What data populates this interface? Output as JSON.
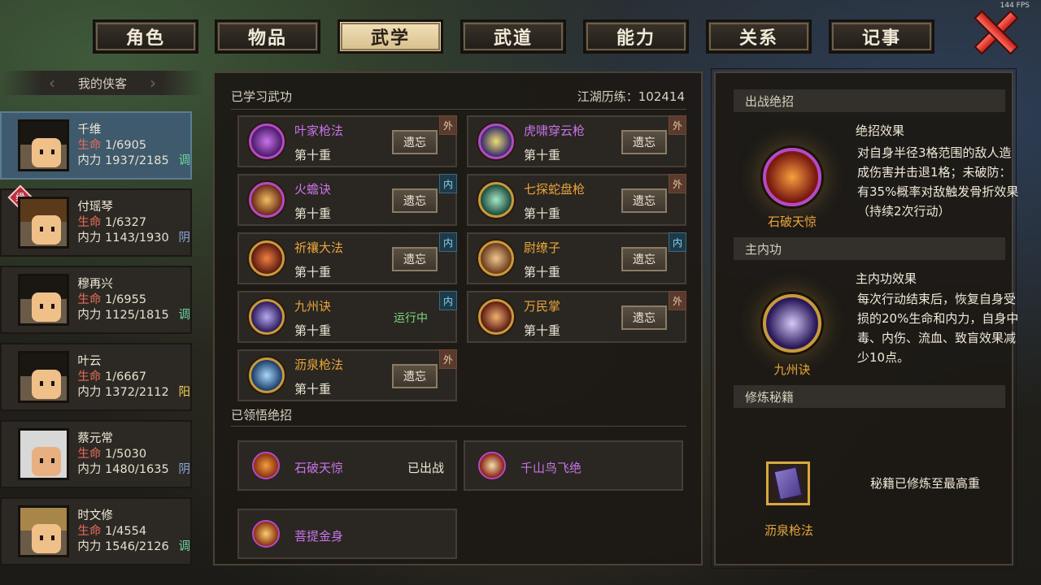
{
  "fps": "144 FPS",
  "tabs": [
    {
      "label": "角色",
      "active": false
    },
    {
      "label": "物品",
      "active": false
    },
    {
      "label": "武学",
      "active": true
    },
    {
      "label": "武道",
      "active": false
    },
    {
      "label": "能力",
      "active": false
    },
    {
      "label": "关系",
      "active": false
    },
    {
      "label": "记事",
      "active": false
    }
  ],
  "roster": {
    "title": "我的侠客",
    "hp_label": "生命",
    "mp_label": "内力",
    "characters": [
      {
        "name": "千维",
        "hp": "1/6905",
        "mp": "1937/2185",
        "tag": "调",
        "selected": true
      },
      {
        "name": "付瑶琴",
        "hp": "1/6327",
        "mp": "1143/1930",
        "tag": "阴",
        "badge": "缘"
      },
      {
        "name": "穆再兴",
        "hp": "1/6955",
        "mp": "1125/1815",
        "tag": "调"
      },
      {
        "name": "叶云",
        "hp": "1/6667",
        "mp": "1372/2112",
        "tag": "阳"
      },
      {
        "name": "蔡元常",
        "hp": "1/5030",
        "mp": "1480/1635",
        "tag": "阴"
      },
      {
        "name": "时文修",
        "hp": "1/4554",
        "mp": "1546/2126",
        "tag": "调"
      }
    ]
  },
  "learned": {
    "title": "已学习武功",
    "exp_label": "江湖历练：",
    "exp_value": "102414",
    "forget_label": "遗忘",
    "level_label": "第十重",
    "running_label": "运行中",
    "skills": [
      {
        "name": "叶家枪法",
        "type": "外",
        "color": "purple"
      },
      {
        "name": "虎啸穿云枪",
        "type": "外",
        "color": "purple"
      },
      {
        "name": "火蟾诀",
        "type": "内",
        "color": "purple"
      },
      {
        "name": "七探蛇盘枪",
        "type": "外",
        "color": "orange"
      },
      {
        "name": "祈禳大法",
        "type": "内",
        "color": "orange"
      },
      {
        "name": "尉缭子",
        "type": "内",
        "color": "orange"
      },
      {
        "name": "九州诀",
        "type": "内",
        "color": "orange",
        "running": true
      },
      {
        "name": "万民掌",
        "type": "外",
        "color": "orange"
      },
      {
        "name": "沥泉枪法",
        "type": "外",
        "color": "orange"
      }
    ]
  },
  "ultimates": {
    "title": "已领悟绝招",
    "items": [
      {
        "name": "石破天惊",
        "status": "已出战"
      },
      {
        "name": "千山鸟飞绝",
        "status": ""
      },
      {
        "name": "菩提金身",
        "status": ""
      }
    ]
  },
  "right": {
    "battle_title": "出战绝招",
    "battle_name": "石破天惊",
    "battle_effect_label": "绝招效果",
    "battle_effect_text": "对自身半径3格范围的敌人造成伤害并击退1格；未破防：有35%概率对敌触发骨折效果（持续2次行动）",
    "inner_title": "主内功",
    "inner_name": "九州诀",
    "inner_effect_label": "主内功效果",
    "inner_effect_text": "每次行动结束后，恢复自身受损的20%生命和内力，自身中毒、内伤、流血、致盲效果减少10点。",
    "manual_title": "修炼秘籍",
    "manual_name": "沥泉枪法",
    "manual_status": "秘籍已修炼至最高重"
  }
}
